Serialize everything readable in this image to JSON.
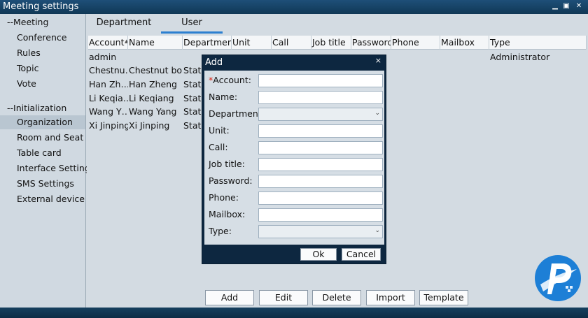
{
  "window": {
    "title": "Meeting settings"
  },
  "sidebar": {
    "groups": [
      {
        "label": "--Meeting",
        "items": [
          "Conference",
          "Rules",
          "Topic",
          "Vote"
        ]
      },
      {
        "label": "--Initialization",
        "items": [
          "Organization",
          "Room and Seat",
          "Table card",
          "Interface Settings",
          "SMS Settings",
          "External device"
        ]
      }
    ],
    "active": "Organization"
  },
  "tabs": [
    {
      "label": "Department"
    },
    {
      "label": "User"
    }
  ],
  "table": {
    "columns": [
      "Account",
      "Name",
      "Department",
      "Unit",
      "Call",
      "Job title",
      "Password",
      "Phone",
      "Mailbox",
      "Type"
    ],
    "rows": [
      [
        "admin",
        "",
        "",
        "",
        "",
        "",
        "",
        "",
        "",
        "Administrator"
      ],
      [
        "Chestnu…",
        "Chestnut bo…",
        "State",
        "",
        "",
        "",
        "",
        "",
        "",
        ""
      ],
      [
        "Han Zh…",
        "Han Zheng",
        "State",
        "",
        "",
        "",
        "",
        "",
        "",
        ""
      ],
      [
        "Li Keqia…",
        "Li Keqiang",
        "State",
        "",
        "",
        "",
        "",
        "",
        "",
        ""
      ],
      [
        "Wang Y…",
        "Wang Yang",
        "State",
        "",
        "",
        "",
        "",
        "",
        "",
        ""
      ],
      [
        "Xi Jinping",
        "Xi Jinping",
        "State",
        "",
        "",
        "",
        "",
        "",
        "",
        ""
      ]
    ]
  },
  "buttons": {
    "add": "Add",
    "edit": "Edit",
    "delete": "Delete",
    "import": "Import",
    "template": "Template"
  },
  "dialog": {
    "title": "Add",
    "close": "×",
    "fields": [
      {
        "label": "Account:",
        "required": true,
        "type": "text",
        "value": ""
      },
      {
        "label": "Name:",
        "type": "text",
        "value": ""
      },
      {
        "label": "Department:",
        "type": "select",
        "value": ""
      },
      {
        "label": "Unit:",
        "type": "text",
        "value": ""
      },
      {
        "label": "Call:",
        "type": "text",
        "value": ""
      },
      {
        "label": "Job title:",
        "type": "text",
        "value": ""
      },
      {
        "label": "Password:",
        "type": "text",
        "value": ""
      },
      {
        "label": "Phone:",
        "type": "text",
        "value": ""
      },
      {
        "label": "Mailbox:",
        "type": "text",
        "value": ""
      },
      {
        "label": "Type:",
        "type": "select",
        "value": ""
      }
    ],
    "ok": "Ok",
    "cancel": "Cancel",
    "required_mark": "*"
  },
  "colors": {
    "accent": "#2b7fd0",
    "title_bar": "#16476c",
    "dialog_frame": "#0d2740"
  },
  "icons": {
    "close": "close-icon",
    "minimize": "minimize-icon",
    "maximize": "maximize-icon",
    "dropdown": "chevron-down-icon",
    "logo": "brand-logo-icon"
  }
}
